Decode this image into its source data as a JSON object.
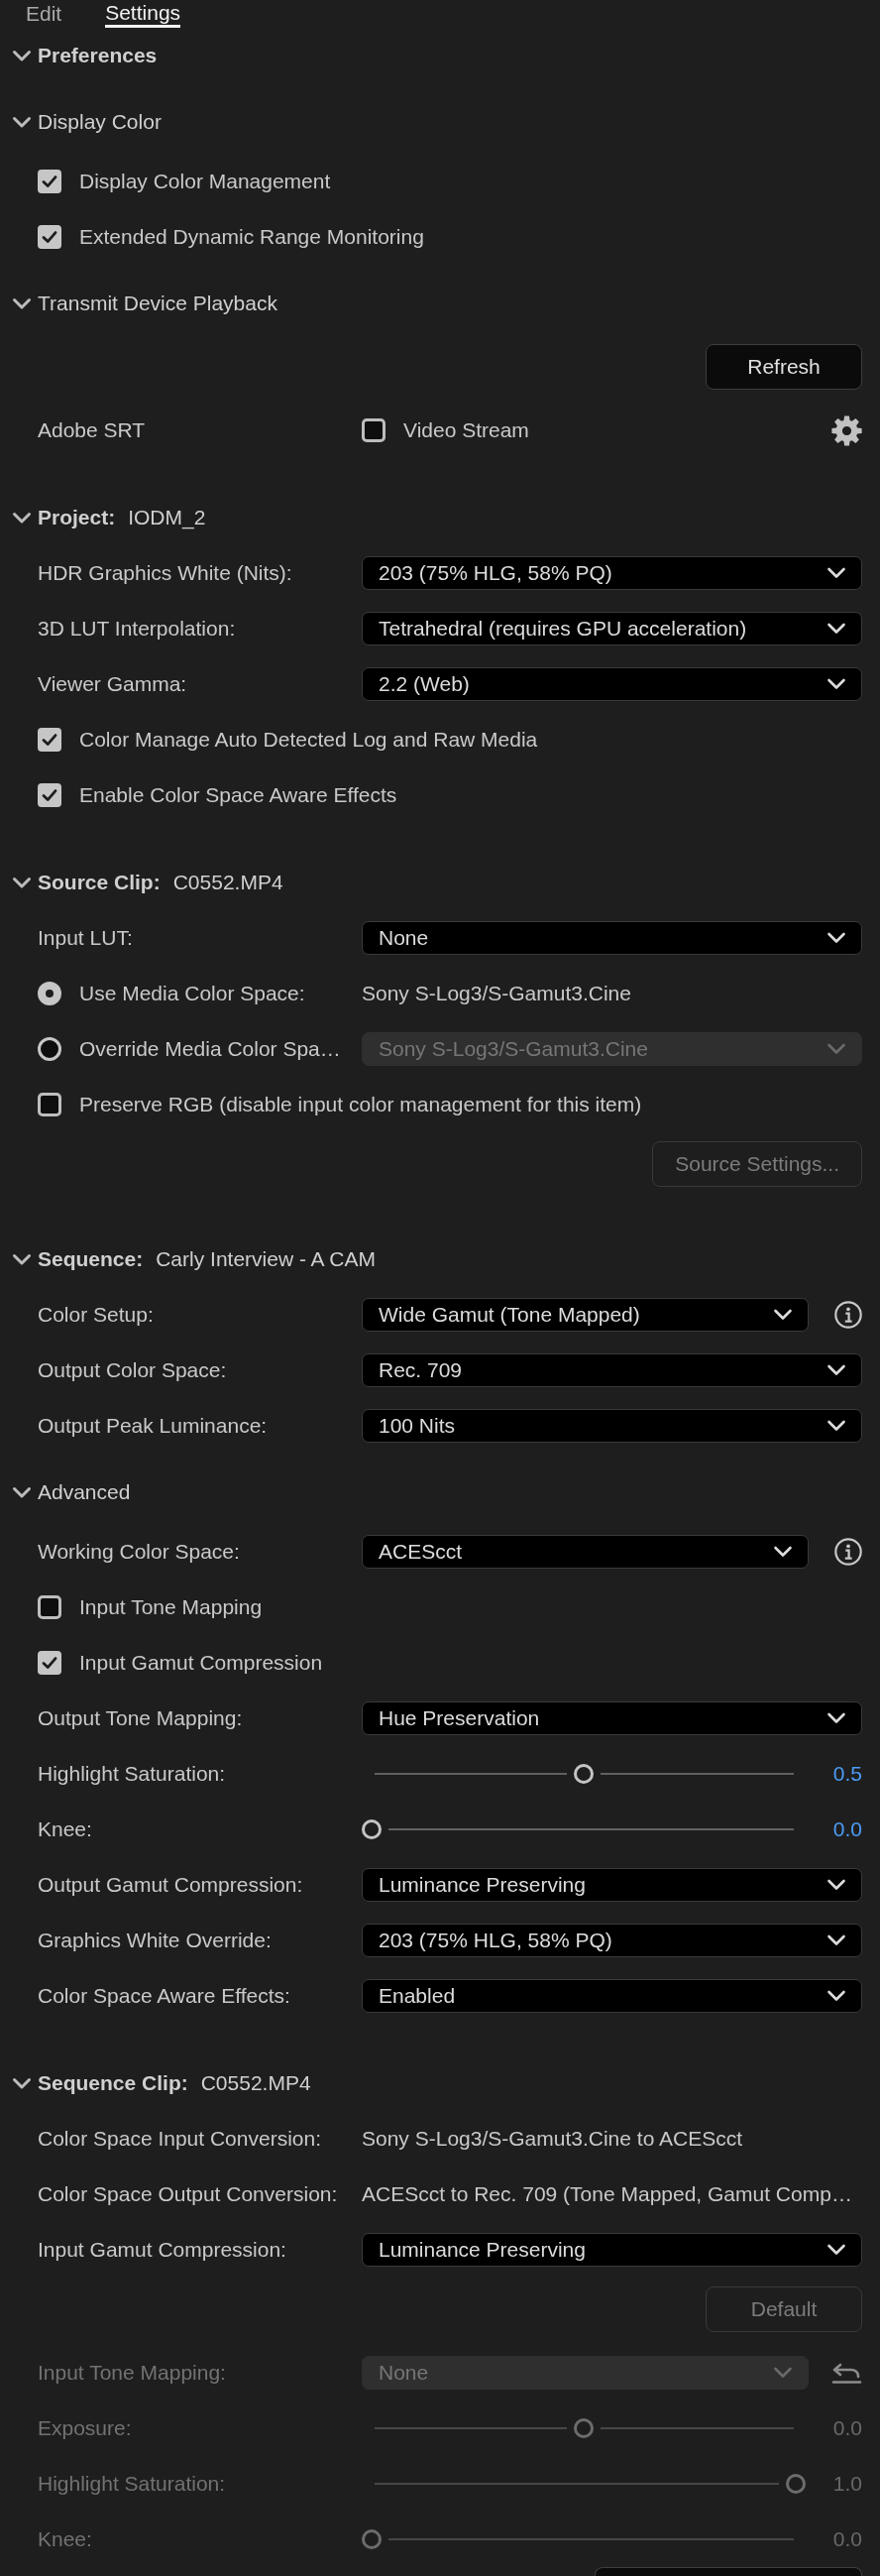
{
  "tabs": [
    {
      "label": "Edit",
      "selected": false
    },
    {
      "label": "Settings",
      "selected": true
    }
  ],
  "sections": [
    {
      "kind": "section",
      "title": "Preferences",
      "expanded": true,
      "children": [
        {
          "kind": "group",
          "title": "Display Color",
          "expanded": true,
          "children": [
            {
              "kind": "checkbox",
              "label": "Display Color Management",
              "checked": true
            },
            {
              "kind": "checkbox",
              "label": "Extended Dynamic Range Monitoring",
              "checked": true
            }
          ]
        },
        {
          "kind": "group",
          "title": "Transmit Device Playback",
          "expanded": true,
          "children": [
            {
              "kind": "button",
              "label": "Refresh",
              "disabled": false
            },
            {
              "kind": "device",
              "label": "Adobe SRT",
              "option": "Video Stream",
              "checked": false
            }
          ]
        }
      ]
    },
    {
      "kind": "section",
      "title": "Project:",
      "value": "IODM_2",
      "expanded": true,
      "children": [
        {
          "kind": "dropdown",
          "label": "HDR Graphics White (Nits):",
          "value": "203 (75% HLG, 58% PQ)",
          "disabled": false
        },
        {
          "kind": "dropdown",
          "label": "3D LUT Interpolation:",
          "value": "Tetrahedral (requires GPU acceleration)",
          "disabled": false
        },
        {
          "kind": "dropdown",
          "label": "Viewer Gamma:",
          "value": "2.2 (Web)",
          "disabled": false
        },
        {
          "kind": "checkbox",
          "label": "Color Manage Auto Detected Log and Raw Media",
          "checked": true
        },
        {
          "kind": "checkbox",
          "label": "Enable Color Space Aware Effects",
          "checked": true
        }
      ]
    },
    {
      "kind": "section",
      "title": "Source Clip:",
      "value": "C0552.MP4",
      "expanded": true,
      "children": [
        {
          "kind": "dropdown",
          "label": "Input LUT:",
          "value": "None",
          "disabled": false
        },
        {
          "kind": "radio",
          "label": "Use Media Color Space:",
          "selected": true,
          "value": "Sony S-Log3/S-Gamut3.Cine"
        },
        {
          "kind": "radio",
          "label": "Override Media Color Spa…",
          "selected": false,
          "dropdown": {
            "value": "Sony S-Log3/S-Gamut3.Cine",
            "disabled": true
          }
        },
        {
          "kind": "checkbox",
          "label": "Preserve RGB (disable input color management for this item)",
          "checked": false
        },
        {
          "kind": "button",
          "label": "Source Settings...",
          "disabled": true
        }
      ]
    },
    {
      "kind": "section",
      "title": "Sequence:",
      "value": "Carly Interview - A CAM",
      "expanded": true,
      "children": [
        {
          "kind": "dropdown",
          "label": "Color Setup:",
          "value": "Wide Gamut (Tone Mapped)",
          "disabled": false,
          "info": true
        },
        {
          "kind": "dropdown",
          "label": "Output Color Space:",
          "value": "Rec. 709",
          "disabled": false
        },
        {
          "kind": "dropdown",
          "label": "Output Peak Luminance:",
          "value": "100 Nits",
          "disabled": false
        },
        {
          "kind": "group",
          "title": "Advanced",
          "expanded": true,
          "children": [
            {
              "kind": "dropdown",
              "label": "Working Color Space:",
              "value": "ACEScct",
              "disabled": false,
              "info": true
            },
            {
              "kind": "checkbox",
              "label": "Input Tone Mapping",
              "checked": false
            },
            {
              "kind": "checkbox",
              "label": "Input Gamut Compression",
              "checked": true
            },
            {
              "kind": "dropdown",
              "label": "Output Tone Mapping:",
              "value": "Hue Preservation",
              "disabled": false
            },
            {
              "kind": "slider",
              "label": "Highlight Saturation:",
              "level": 0.5,
              "reading": "0.5",
              "disabled": false
            },
            {
              "kind": "slider",
              "label": "Knee:",
              "level": 0,
              "reading": "0.0",
              "disabled": false
            },
            {
              "kind": "dropdown",
              "label": "Output Gamut Compression:",
              "value": "Luminance Preserving",
              "disabled": false
            },
            {
              "kind": "dropdown",
              "label": "Graphics White Override:",
              "value": "203 (75% HLG, 58% PQ)",
              "disabled": false
            },
            {
              "kind": "dropdown",
              "label": "Color Space Aware Effects:",
              "value": "Enabled",
              "disabled": false
            }
          ]
        }
      ]
    },
    {
      "kind": "section",
      "title": "Sequence Clip:",
      "value": "C0552.MP4",
      "expanded": true,
      "children": [
        {
          "kind": "readout",
          "label": "Color Space Input Conversion:",
          "value": "Sony S-Log3/S-Gamut3.Cine to ACEScct"
        },
        {
          "kind": "readout",
          "label": "Color Space Output Conversion:",
          "value": "ACEScct to Rec. 709 (Tone Mapped, Gamut Comp…"
        },
        {
          "kind": "dropdown",
          "label": "Input Gamut Compression:",
          "value": "Luminance Preserving",
          "disabled": false
        },
        {
          "kind": "button",
          "label": "Default",
          "disabled": true
        },
        {
          "kind": "dropdown",
          "label": "Input Tone Mapping:",
          "value": "None",
          "disabled": true,
          "reset": true
        },
        {
          "kind": "slider",
          "label": "Exposure:",
          "level": 0.5,
          "reading": "0.0",
          "disabled": true
        },
        {
          "kind": "slider",
          "label": "Highlight Saturation:",
          "level": 1,
          "reading": "1.0",
          "disabled": true
        },
        {
          "kind": "slider",
          "label": "Knee:",
          "level": 0,
          "reading": "0.0",
          "disabled": true
        },
        {
          "kind": "button",
          "disabled": false
        }
      ]
    }
  ]
}
